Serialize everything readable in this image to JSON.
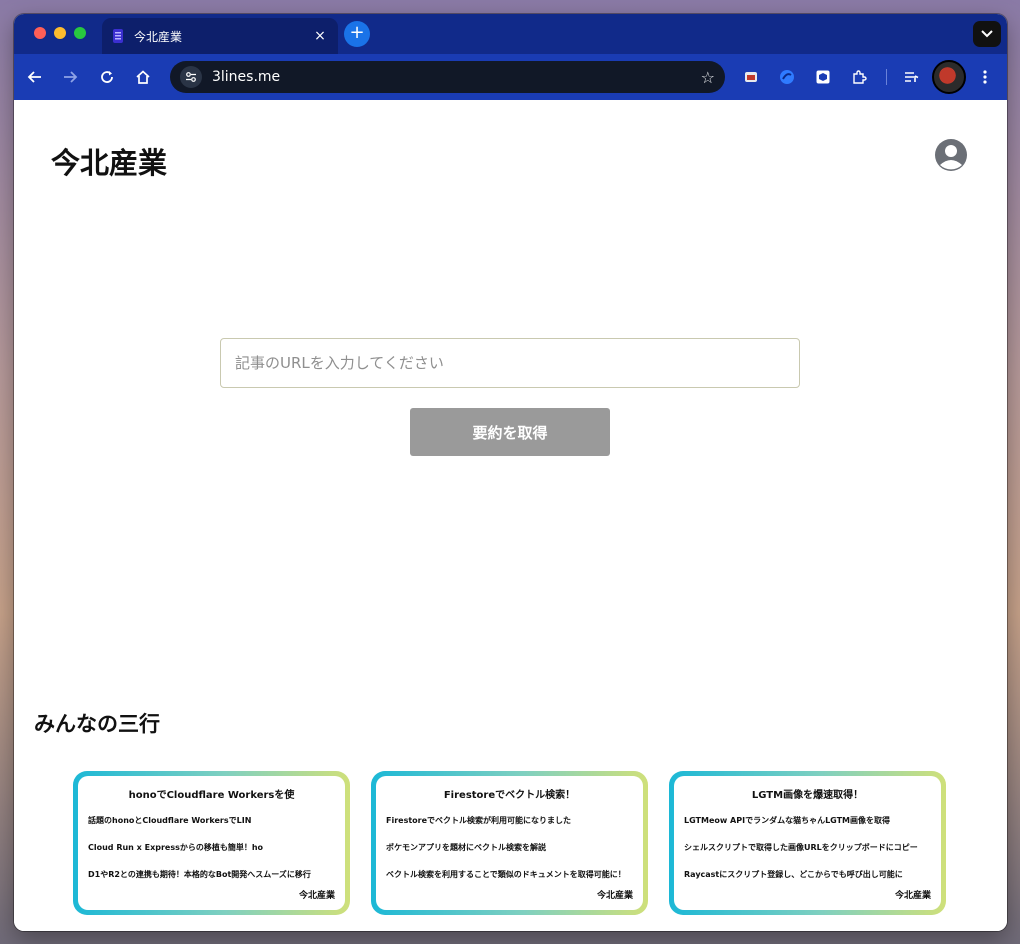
{
  "browser": {
    "tab_title": "今北産業",
    "tab_close": "×",
    "new_tab": "+",
    "url": "3lines.me"
  },
  "header": {
    "site_title": "今北産業"
  },
  "form": {
    "placeholder": "記事のURLを入力してください",
    "submit_label": "要約を取得"
  },
  "section": {
    "title": "みんなの三行"
  },
  "cards": [
    {
      "title": "honoでCloudflare Workersを使",
      "lines": [
        "話題のhonoとCloudflare WorkersでLIN",
        "Cloud Run x Expressからの移植も簡単！ho",
        "D1やR2との連携も期待！本格的なBot開発へスムーズに移行"
      ],
      "author": "今北産業"
    },
    {
      "title": "Firestoreでベクトル検索！",
      "lines": [
        "Firestoreでベクトル検索が利用可能になりました",
        "ポケモンアプリを題材にベクトル検索を解説",
        "ベクトル検索を利用することで類似のドキュメントを取得可能に！"
      ],
      "author": "今北産業"
    },
    {
      "title": "LGTM画像を爆速取得！",
      "lines": [
        "LGTMeow APIでランダムな猫ちゃんLGTM画像を取得",
        "シェルスクリプトで取得した画像URLをクリップボードにコピー",
        "Raycastにスクリプト登録し、どこからでも呼び出し可能に"
      ],
      "author": "今北産業"
    }
  ],
  "colors": {
    "tab_bar": "#112a8a",
    "toolbar": "#1a3cb4",
    "button_disabled": "#9a9a9a",
    "card_gradient_start": "#1cb8d6",
    "card_gradient_end": "#cfe07a"
  },
  "icons": [
    "back-icon",
    "forward-icon",
    "reload-icon",
    "home-icon",
    "site-settings-icon",
    "bookmark-star-icon",
    "extension-icon",
    "account-circle-icon"
  ]
}
